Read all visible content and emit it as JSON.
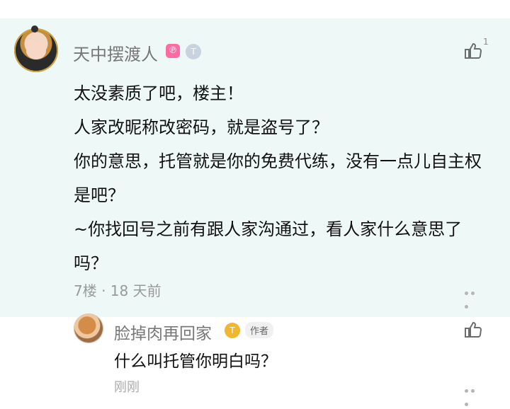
{
  "comment": {
    "username": "天中摆渡人",
    "badge_pink": "℗",
    "badge_level": "T",
    "like_count": "1",
    "lines": [
      "太没素质了吧，楼主！",
      "人家改昵称改密码，就是盗号了？",
      "你的意思，托管就是你的免费代练，没有一点儿自主权",
      "是吧？",
      "~你找回号之前有跟人家沟通过，看人家什么意思了",
      "吗？"
    ],
    "meta": "7楼 · 18 天前"
  },
  "reply": {
    "username": "脸掉肉再回家",
    "badge_level": "T",
    "author_tag": "作者",
    "text": "什么叫托管你明白吗？",
    "time": "刚刚"
  }
}
